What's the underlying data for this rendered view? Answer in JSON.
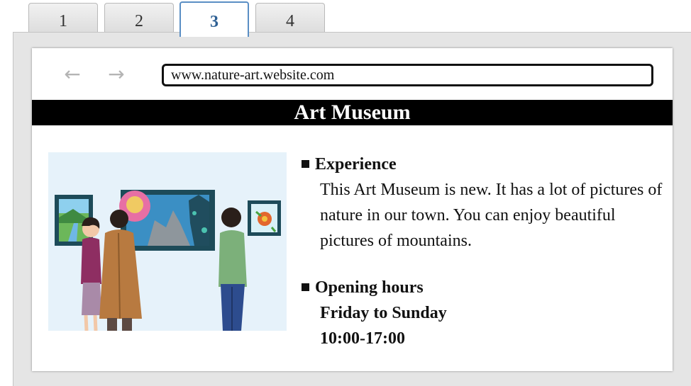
{
  "tabs": [
    {
      "label": "1"
    },
    {
      "label": "2"
    },
    {
      "label": "3"
    },
    {
      "label": "4"
    }
  ],
  "active_tab": "3",
  "browser": {
    "back_icon": "arrow-left-icon",
    "forward_icon": "arrow-right-icon",
    "url": "www.nature-art.website.com"
  },
  "page": {
    "title": "Art Museum",
    "sections": [
      {
        "heading": "Experience",
        "text": "This Art Museum is new. It has a lot of pictures of nature in our town. You can enjoy beautiful pictures of mountains."
      },
      {
        "heading": "Opening hours",
        "days": "Friday to Sunday",
        "time": "10:00-17:00"
      }
    ]
  }
}
